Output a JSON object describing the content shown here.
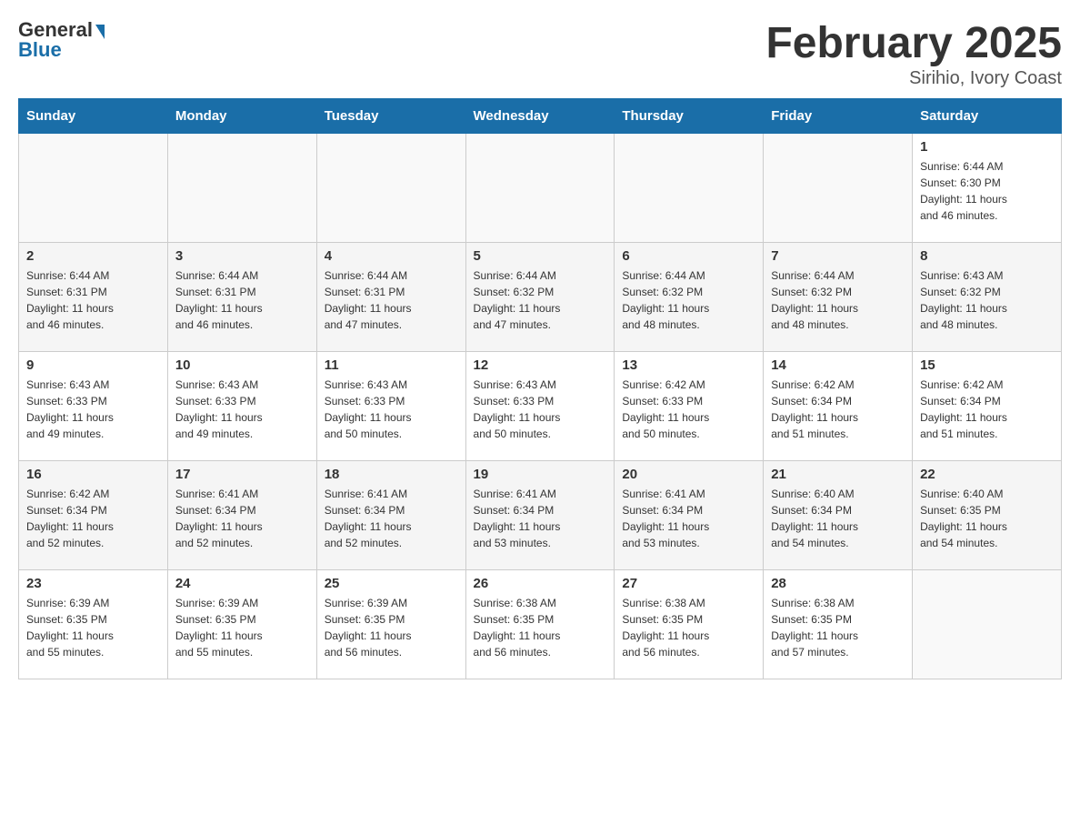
{
  "header": {
    "logo_general": "General",
    "logo_blue": "Blue",
    "month_title": "February 2025",
    "location": "Sirihio, Ivory Coast"
  },
  "weekdays": [
    "Sunday",
    "Monday",
    "Tuesday",
    "Wednesday",
    "Thursday",
    "Friday",
    "Saturday"
  ],
  "weeks": [
    {
      "days": [
        {
          "number": "",
          "info": ""
        },
        {
          "number": "",
          "info": ""
        },
        {
          "number": "",
          "info": ""
        },
        {
          "number": "",
          "info": ""
        },
        {
          "number": "",
          "info": ""
        },
        {
          "number": "",
          "info": ""
        },
        {
          "number": "1",
          "info": "Sunrise: 6:44 AM\nSunset: 6:30 PM\nDaylight: 11 hours\nand 46 minutes."
        }
      ]
    },
    {
      "days": [
        {
          "number": "2",
          "info": "Sunrise: 6:44 AM\nSunset: 6:31 PM\nDaylight: 11 hours\nand 46 minutes."
        },
        {
          "number": "3",
          "info": "Sunrise: 6:44 AM\nSunset: 6:31 PM\nDaylight: 11 hours\nand 46 minutes."
        },
        {
          "number": "4",
          "info": "Sunrise: 6:44 AM\nSunset: 6:31 PM\nDaylight: 11 hours\nand 47 minutes."
        },
        {
          "number": "5",
          "info": "Sunrise: 6:44 AM\nSunset: 6:32 PM\nDaylight: 11 hours\nand 47 minutes."
        },
        {
          "number": "6",
          "info": "Sunrise: 6:44 AM\nSunset: 6:32 PM\nDaylight: 11 hours\nand 48 minutes."
        },
        {
          "number": "7",
          "info": "Sunrise: 6:44 AM\nSunset: 6:32 PM\nDaylight: 11 hours\nand 48 minutes."
        },
        {
          "number": "8",
          "info": "Sunrise: 6:43 AM\nSunset: 6:32 PM\nDaylight: 11 hours\nand 48 minutes."
        }
      ]
    },
    {
      "days": [
        {
          "number": "9",
          "info": "Sunrise: 6:43 AM\nSunset: 6:33 PM\nDaylight: 11 hours\nand 49 minutes."
        },
        {
          "number": "10",
          "info": "Sunrise: 6:43 AM\nSunset: 6:33 PM\nDaylight: 11 hours\nand 49 minutes."
        },
        {
          "number": "11",
          "info": "Sunrise: 6:43 AM\nSunset: 6:33 PM\nDaylight: 11 hours\nand 50 minutes."
        },
        {
          "number": "12",
          "info": "Sunrise: 6:43 AM\nSunset: 6:33 PM\nDaylight: 11 hours\nand 50 minutes."
        },
        {
          "number": "13",
          "info": "Sunrise: 6:42 AM\nSunset: 6:33 PM\nDaylight: 11 hours\nand 50 minutes."
        },
        {
          "number": "14",
          "info": "Sunrise: 6:42 AM\nSunset: 6:34 PM\nDaylight: 11 hours\nand 51 minutes."
        },
        {
          "number": "15",
          "info": "Sunrise: 6:42 AM\nSunset: 6:34 PM\nDaylight: 11 hours\nand 51 minutes."
        }
      ]
    },
    {
      "days": [
        {
          "number": "16",
          "info": "Sunrise: 6:42 AM\nSunset: 6:34 PM\nDaylight: 11 hours\nand 52 minutes."
        },
        {
          "number": "17",
          "info": "Sunrise: 6:41 AM\nSunset: 6:34 PM\nDaylight: 11 hours\nand 52 minutes."
        },
        {
          "number": "18",
          "info": "Sunrise: 6:41 AM\nSunset: 6:34 PM\nDaylight: 11 hours\nand 52 minutes."
        },
        {
          "number": "19",
          "info": "Sunrise: 6:41 AM\nSunset: 6:34 PM\nDaylight: 11 hours\nand 53 minutes."
        },
        {
          "number": "20",
          "info": "Sunrise: 6:41 AM\nSunset: 6:34 PM\nDaylight: 11 hours\nand 53 minutes."
        },
        {
          "number": "21",
          "info": "Sunrise: 6:40 AM\nSunset: 6:34 PM\nDaylight: 11 hours\nand 54 minutes."
        },
        {
          "number": "22",
          "info": "Sunrise: 6:40 AM\nSunset: 6:35 PM\nDaylight: 11 hours\nand 54 minutes."
        }
      ]
    },
    {
      "days": [
        {
          "number": "23",
          "info": "Sunrise: 6:39 AM\nSunset: 6:35 PM\nDaylight: 11 hours\nand 55 minutes."
        },
        {
          "number": "24",
          "info": "Sunrise: 6:39 AM\nSunset: 6:35 PM\nDaylight: 11 hours\nand 55 minutes."
        },
        {
          "number": "25",
          "info": "Sunrise: 6:39 AM\nSunset: 6:35 PM\nDaylight: 11 hours\nand 56 minutes."
        },
        {
          "number": "26",
          "info": "Sunrise: 6:38 AM\nSunset: 6:35 PM\nDaylight: 11 hours\nand 56 minutes."
        },
        {
          "number": "27",
          "info": "Sunrise: 6:38 AM\nSunset: 6:35 PM\nDaylight: 11 hours\nand 56 minutes."
        },
        {
          "number": "28",
          "info": "Sunrise: 6:38 AM\nSunset: 6:35 PM\nDaylight: 11 hours\nand 57 minutes."
        },
        {
          "number": "",
          "info": ""
        }
      ]
    }
  ]
}
